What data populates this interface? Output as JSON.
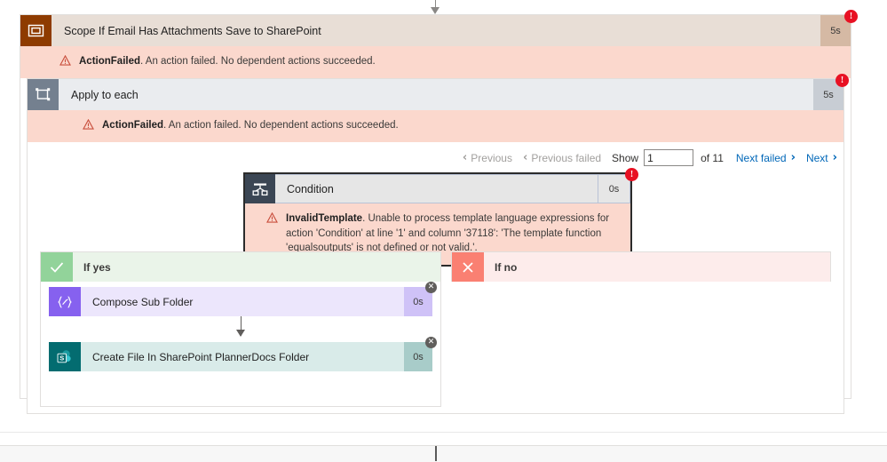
{
  "flow": {
    "scope": {
      "title": "Scope If Email Has Attachments Save to SharePoint",
      "duration": "5s",
      "icon": "scope-icon",
      "badge": "!",
      "error": {
        "code": "ActionFailed",
        "message": ". An action failed. No dependent actions succeeded."
      }
    },
    "foreach": {
      "title": "Apply to each",
      "duration": "5s",
      "icon": "loop-icon",
      "badge": "!",
      "error": {
        "code": "ActionFailed",
        "message": ". An action failed. No dependent actions succeeded."
      }
    },
    "pager": {
      "previous": "Previous",
      "previous_failed": "Previous failed",
      "show_label": "Show",
      "page_value": "1",
      "page_placeholder": "1",
      "of_label": "of 11",
      "next_failed": "Next failed",
      "next": "Next",
      "chevron_left": "‹",
      "chevron_right": "›"
    },
    "condition": {
      "title": "Condition",
      "duration": "0s",
      "icon": "condition-icon",
      "badge": "!",
      "error": {
        "code": "InvalidTemplate",
        "message": ". Unable to process template language expressions for action 'Condition' at line '1' and column '37118': 'The template function 'equalsoutputs' is not defined or not valid.'."
      }
    },
    "branch_yes": {
      "label": "If yes",
      "icon": "check-icon",
      "actions": [
        {
          "title": "Compose Sub Folder",
          "duration": "0s",
          "icon": "compose-icon",
          "close": "✕"
        },
        {
          "title": "Create File In SharePoint PlannerDocs Folder",
          "duration": "0s",
          "icon": "sharepoint-icon",
          "close": "✕"
        }
      ]
    },
    "branch_no": {
      "label": "If no",
      "icon": "cross-icon",
      "actions": []
    }
  },
  "colors": {
    "scope_accent": "#8e3b00",
    "foreach_accent": "#74808f",
    "condition_accent": "#3b4654",
    "error_bg": "#fbd8cd",
    "badge_red": "#e81123",
    "link_blue": "#0067b8",
    "yes_green": "#92d39a",
    "no_red": "#fa8072",
    "compose_purple": "#8661ef",
    "sharepoint_teal": "#036c70"
  }
}
